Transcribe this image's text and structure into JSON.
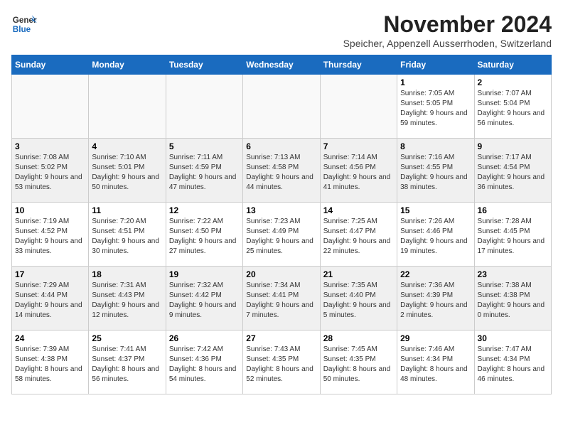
{
  "header": {
    "logo_line1": "General",
    "logo_line2": "Blue",
    "month_title": "November 2024",
    "location": "Speicher, Appenzell Ausserrhoden, Switzerland"
  },
  "days_of_week": [
    "Sunday",
    "Monday",
    "Tuesday",
    "Wednesday",
    "Thursday",
    "Friday",
    "Saturday"
  ],
  "weeks": [
    [
      {
        "day": "",
        "info": ""
      },
      {
        "day": "",
        "info": ""
      },
      {
        "day": "",
        "info": ""
      },
      {
        "day": "",
        "info": ""
      },
      {
        "day": "",
        "info": ""
      },
      {
        "day": "1",
        "info": "Sunrise: 7:05 AM\nSunset: 5:05 PM\nDaylight: 9 hours and 59 minutes."
      },
      {
        "day": "2",
        "info": "Sunrise: 7:07 AM\nSunset: 5:04 PM\nDaylight: 9 hours and 56 minutes."
      }
    ],
    [
      {
        "day": "3",
        "info": "Sunrise: 7:08 AM\nSunset: 5:02 PM\nDaylight: 9 hours and 53 minutes."
      },
      {
        "day": "4",
        "info": "Sunrise: 7:10 AM\nSunset: 5:01 PM\nDaylight: 9 hours and 50 minutes."
      },
      {
        "day": "5",
        "info": "Sunrise: 7:11 AM\nSunset: 4:59 PM\nDaylight: 9 hours and 47 minutes."
      },
      {
        "day": "6",
        "info": "Sunrise: 7:13 AM\nSunset: 4:58 PM\nDaylight: 9 hours and 44 minutes."
      },
      {
        "day": "7",
        "info": "Sunrise: 7:14 AM\nSunset: 4:56 PM\nDaylight: 9 hours and 41 minutes."
      },
      {
        "day": "8",
        "info": "Sunrise: 7:16 AM\nSunset: 4:55 PM\nDaylight: 9 hours and 38 minutes."
      },
      {
        "day": "9",
        "info": "Sunrise: 7:17 AM\nSunset: 4:54 PM\nDaylight: 9 hours and 36 minutes."
      }
    ],
    [
      {
        "day": "10",
        "info": "Sunrise: 7:19 AM\nSunset: 4:52 PM\nDaylight: 9 hours and 33 minutes."
      },
      {
        "day": "11",
        "info": "Sunrise: 7:20 AM\nSunset: 4:51 PM\nDaylight: 9 hours and 30 minutes."
      },
      {
        "day": "12",
        "info": "Sunrise: 7:22 AM\nSunset: 4:50 PM\nDaylight: 9 hours and 27 minutes."
      },
      {
        "day": "13",
        "info": "Sunrise: 7:23 AM\nSunset: 4:49 PM\nDaylight: 9 hours and 25 minutes."
      },
      {
        "day": "14",
        "info": "Sunrise: 7:25 AM\nSunset: 4:47 PM\nDaylight: 9 hours and 22 minutes."
      },
      {
        "day": "15",
        "info": "Sunrise: 7:26 AM\nSunset: 4:46 PM\nDaylight: 9 hours and 19 minutes."
      },
      {
        "day": "16",
        "info": "Sunrise: 7:28 AM\nSunset: 4:45 PM\nDaylight: 9 hours and 17 minutes."
      }
    ],
    [
      {
        "day": "17",
        "info": "Sunrise: 7:29 AM\nSunset: 4:44 PM\nDaylight: 9 hours and 14 minutes."
      },
      {
        "day": "18",
        "info": "Sunrise: 7:31 AM\nSunset: 4:43 PM\nDaylight: 9 hours and 12 minutes."
      },
      {
        "day": "19",
        "info": "Sunrise: 7:32 AM\nSunset: 4:42 PM\nDaylight: 9 hours and 9 minutes."
      },
      {
        "day": "20",
        "info": "Sunrise: 7:34 AM\nSunset: 4:41 PM\nDaylight: 9 hours and 7 minutes."
      },
      {
        "day": "21",
        "info": "Sunrise: 7:35 AM\nSunset: 4:40 PM\nDaylight: 9 hours and 5 minutes."
      },
      {
        "day": "22",
        "info": "Sunrise: 7:36 AM\nSunset: 4:39 PM\nDaylight: 9 hours and 2 minutes."
      },
      {
        "day": "23",
        "info": "Sunrise: 7:38 AM\nSunset: 4:38 PM\nDaylight: 9 hours and 0 minutes."
      }
    ],
    [
      {
        "day": "24",
        "info": "Sunrise: 7:39 AM\nSunset: 4:38 PM\nDaylight: 8 hours and 58 minutes."
      },
      {
        "day": "25",
        "info": "Sunrise: 7:41 AM\nSunset: 4:37 PM\nDaylight: 8 hours and 56 minutes."
      },
      {
        "day": "26",
        "info": "Sunrise: 7:42 AM\nSunset: 4:36 PM\nDaylight: 8 hours and 54 minutes."
      },
      {
        "day": "27",
        "info": "Sunrise: 7:43 AM\nSunset: 4:35 PM\nDaylight: 8 hours and 52 minutes."
      },
      {
        "day": "28",
        "info": "Sunrise: 7:45 AM\nSunset: 4:35 PM\nDaylight: 8 hours and 50 minutes."
      },
      {
        "day": "29",
        "info": "Sunrise: 7:46 AM\nSunset: 4:34 PM\nDaylight: 8 hours and 48 minutes."
      },
      {
        "day": "30",
        "info": "Sunrise: 7:47 AM\nSunset: 4:34 PM\nDaylight: 8 hours and 46 minutes."
      }
    ]
  ]
}
